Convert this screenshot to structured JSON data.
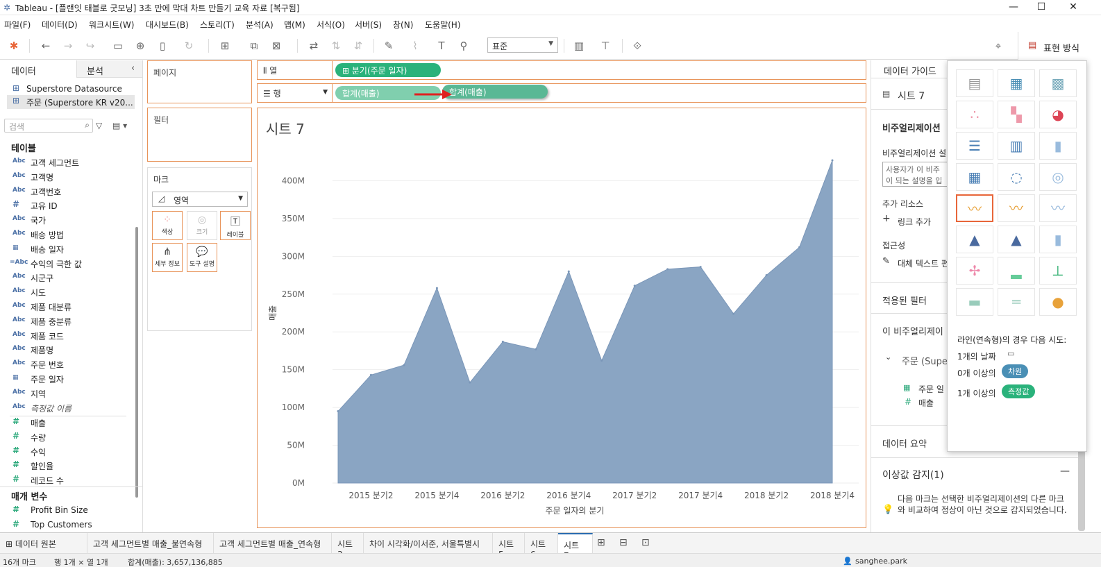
{
  "window": {
    "title": "Tableau - [플랜잇 태블로 굿모닝] 3초 만에 막대 차트 만들기 교육 자료 [복구됨]",
    "logo_icon": "tableau-logo-icon"
  },
  "menu": [
    "파일(F)",
    "데이터(D)",
    "워크시트(W)",
    "대시보드(B)",
    "스토리(T)",
    "분석(A)",
    "맵(M)",
    "서식(O)",
    "서버(S)",
    "창(N)",
    "도움말(H)"
  ],
  "toolbar": {
    "fit": "표준",
    "showme": "표현 방식"
  },
  "leftpanel": {
    "tab_data": "데이터",
    "tab_analysis": "분석",
    "datasources": [
      "Superstore Datasource",
      "주문 (Superstore KR v20..."
    ],
    "search_placeholder": "검색",
    "tables_header": "테이블",
    "params_header": "매개 변수",
    "dims": [
      {
        "icon": "Abc",
        "name": "고객 세그먼트"
      },
      {
        "icon": "Abc",
        "name": "고객명"
      },
      {
        "icon": "Abc",
        "name": "고객번호"
      },
      {
        "icon": "#",
        "name": "고유 ID"
      },
      {
        "icon": "Abc",
        "name": "국가"
      },
      {
        "icon": "Abc",
        "name": "배송 방법"
      },
      {
        "icon": "cal",
        "name": "배송 일자"
      },
      {
        "icon": "=Abc",
        "name": "수익의 극한 값"
      },
      {
        "icon": "Abc",
        "name": "시군구"
      },
      {
        "icon": "Abc",
        "name": "시도"
      },
      {
        "icon": "Abc",
        "name": "제품 대분류"
      },
      {
        "icon": "Abc",
        "name": "제품 중분류"
      },
      {
        "icon": "Abc",
        "name": "제품 코드"
      },
      {
        "icon": "Abc",
        "name": "제품명"
      },
      {
        "icon": "Abc",
        "name": "주문 번호"
      },
      {
        "icon": "cal",
        "name": "주문 일자"
      },
      {
        "icon": "Abc",
        "name": "지역"
      },
      {
        "icon": "Abc",
        "name": "측정값 이름"
      }
    ],
    "measures": [
      "매출",
      "수량",
      "수익",
      "할인율",
      "레코드 수"
    ],
    "params": [
      "Profit Bin Size",
      "Top Customers"
    ]
  },
  "cards": {
    "pages": "페이지",
    "filters": "필터",
    "marks": "마크",
    "mark_type": "영역",
    "mark_buttons": [
      "색상",
      "크기",
      "레이블",
      "세부 정보",
      "도구 설명"
    ]
  },
  "shelves": {
    "columns_label": "열",
    "rows_label": "행",
    "columns_pill": "분기(주문 일자)",
    "rows_pill": "합계(매출)",
    "rows_pill_drag": "합계(매출)"
  },
  "view": {
    "sheet_title": "시트 7"
  },
  "chart_data": {
    "type": "area",
    "title": "시트 7",
    "xlabel": "주문 일자의 분기",
    "ylabel": "매출",
    "ylim": [
      0,
      450000000
    ],
    "yticks": [
      "0M",
      "50M",
      "100M",
      "150M",
      "200M",
      "250M",
      "300M",
      "350M",
      "400M"
    ],
    "xticks": [
      "2015 분기2",
      "2015 분기4",
      "2016 분기2",
      "2016 분기4",
      "2017 분기2",
      "2017 분기4",
      "2018 분기2",
      "2018 분기4"
    ],
    "x": [
      "2015 분기1",
      "2015 분기2",
      "2015 분기3",
      "2015 분기4",
      "2016 분기1",
      "2016 분기2",
      "2016 분기3",
      "2016 분기4",
      "2017 분기1",
      "2017 분기2",
      "2017 분기3",
      "2017 분기4",
      "2018 분기1",
      "2018 분기2",
      "2018 분기3",
      "2018 분기4"
    ],
    "series": [
      {
        "values": [
          95000000,
          143000000,
          156000000,
          258000000,
          133000000,
          187000000,
          177000000,
          280000000,
          162000000,
          261000000,
          283000000,
          286000000,
          224000000,
          275000000,
          312000000,
          427000000
        ]
      }
    ],
    "color": "#8aa5c3",
    "grid": true
  },
  "rightpanel": {
    "title": "데이터 가이드",
    "sheet": "시트 7",
    "viz_header": "비주얼리제이션",
    "viz_desc_label": "비주얼리제이션 설",
    "viz_desc_placeholder": "사용자가 이 비주",
    "viz_desc_placeholder2": "이 되는 설명을 입",
    "resources": "추가 리소스",
    "add_link": "링크 추가",
    "access": "접근성",
    "alt_text": "대체 텍스트 편",
    "applied_filters": "적용된 필터",
    "this_viz": "이 비주얼리제이",
    "source": "주문 (Supe",
    "fields": [
      "주문 일",
      "매출"
    ],
    "data_summary": "데이터 요약",
    "outliers": "이상값 감지(1)",
    "outlier_text": "다음 마크는 선택한 비주얼리제이션의 다른 마크와 비교하여 정상이 아닌 것으로 감지되었습니다."
  },
  "showme": {
    "hint": "라인(연속형)의 경우 다음 시도:",
    "row1": "1개의 날짜",
    "row2_a": "0개 이상의",
    "row2_tag": "차원",
    "row3_a": "1개 이상의",
    "row3_tag": "측정값"
  },
  "bottom": {
    "tabs": [
      "데이터 원본",
      "고객 세그먼트별 매출_불연속형",
      "고객 세그먼트별 매출_연속형",
      "시트 3",
      "차이 시각화/이서준, 서울특별시",
      "시트 5",
      "시트 6",
      "시트 7"
    ],
    "active": "시트 7"
  },
  "status": {
    "marks": "16개 마크",
    "rows": "행 1개 × 열 1개",
    "sum": "합계(매출): 3,657,136,885",
    "user": "sanghee.park"
  }
}
